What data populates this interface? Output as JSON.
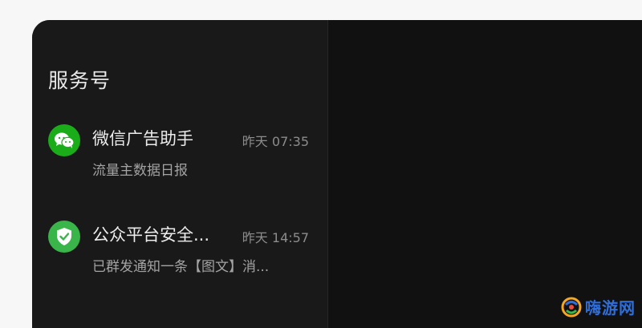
{
  "colors": {
    "wechat_green": "#1aad19",
    "security_green": "#39b54a",
    "window_bg": "#111111",
    "sidebar_bg": "#191919"
  },
  "sidebar": {
    "title": "服务号",
    "chats": [
      {
        "name": "微信广告助手",
        "time": "昨天 07:35",
        "preview": "流量主数据日报",
        "icon": "wechat-chat-icon"
      },
      {
        "name": "公众平台安全...",
        "time": "昨天 14:57",
        "preview": "已群发通知一条【图文】消...",
        "icon": "shield-check-icon"
      }
    ]
  },
  "watermark": {
    "text": "嗨游网",
    "icon": "logo-icon"
  }
}
